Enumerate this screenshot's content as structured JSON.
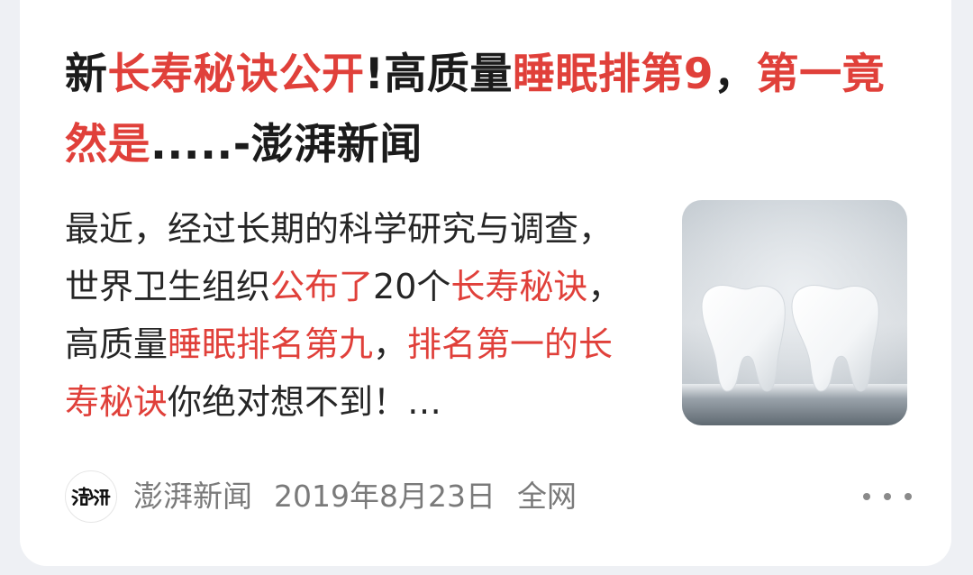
{
  "article": {
    "title_parts": [
      {
        "text": "新",
        "hl": false
      },
      {
        "text": "长寿秘诀公开",
        "hl": true
      },
      {
        "text": "!高质量",
        "hl": false
      },
      {
        "text": "睡眠排第9",
        "hl": true
      },
      {
        "text": "，",
        "hl": false
      },
      {
        "text": "第一竟然是",
        "hl": true
      },
      {
        "text": ".....-澎湃新闻",
        "hl": false
      }
    ],
    "summary_parts": [
      {
        "text": "最近，经过长期的科学研究与调查，世界卫生组织",
        "hl": false
      },
      {
        "text": "公布了",
        "hl": true
      },
      {
        "text": "20个",
        "hl": false
      },
      {
        "text": "长寿秘诀",
        "hl": true
      },
      {
        "text": "，高质量",
        "hl": false
      },
      {
        "text": "睡眠排名第九",
        "hl": true
      },
      {
        "text": "，",
        "hl": false
      },
      {
        "text": "排名第一的长寿秘诀",
        "hl": true
      },
      {
        "text": "你绝对想不到！…",
        "hl": false
      }
    ],
    "thumbnail_icon": "teeth-image",
    "source": {
      "logo_text": "澎湃",
      "name": "澎湃新闻",
      "date": "2019年8月23日",
      "scope": "全网"
    },
    "more_icon": "more-dots-icon"
  },
  "colors": {
    "highlight": "#e0403a",
    "text": "#1b1b1b",
    "meta": "#7a7a7a"
  }
}
